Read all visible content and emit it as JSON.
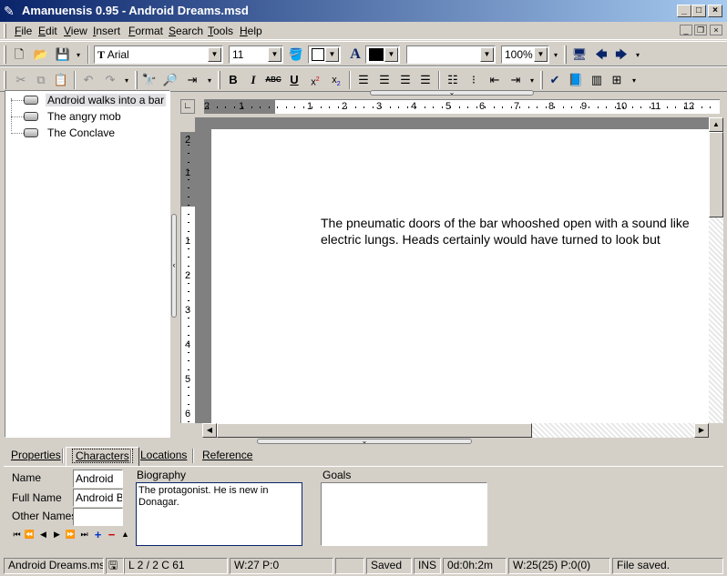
{
  "window": {
    "title": "Amanuensis 0.95 - Android Dreams.msd",
    "controls": {
      "minimize": "_",
      "maximize": "□",
      "close": "×"
    }
  },
  "menu": [
    "File",
    "Edit",
    "View",
    "Insert",
    "Format",
    "Search",
    "Tools",
    "Help"
  ],
  "toolbar": {
    "font_name": "Arial",
    "font_size": "11",
    "zoom": "100%",
    "style_value": "",
    "icons": [
      "new-document",
      "open-folder",
      "save-disk",
      "bold",
      "italic",
      "strikethrough",
      "underline",
      "superscript",
      "subscript",
      "align-left",
      "align-center",
      "align-right",
      "justify"
    ]
  },
  "tree": {
    "items": [
      {
        "label": "Android walks into a bar",
        "selected": true
      },
      {
        "label": "The angry mob",
        "selected": false
      },
      {
        "label": "The Conclave",
        "selected": false
      }
    ]
  },
  "ruler": {
    "horizontal": [
      "2",
      "1",
      "1",
      "2",
      "3",
      "4",
      "5",
      "6",
      "7",
      "8",
      "9",
      "10",
      "11",
      "12"
    ],
    "vertical": [
      "2",
      "1",
      "1",
      "2",
      "3",
      "4",
      "5",
      "6"
    ]
  },
  "document": {
    "lines": [
      "The pneumatic doors of the bar whooshed open with a sound like",
      "electric lungs. Heads certainly would have turned to look but"
    ]
  },
  "tabs": [
    {
      "label": "Properties",
      "active": false
    },
    {
      "label": "Characters",
      "active": true
    },
    {
      "label": "Locations",
      "active": false
    },
    {
      "label": "Reference",
      "active": false
    }
  ],
  "characters": {
    "name_label": "Name",
    "name_value": "Android",
    "full_name_label": "Full Name",
    "full_name_value": "Android Bl",
    "other_names_label": "Other Names",
    "other_names_value": "",
    "biography_label": "Biography",
    "biography_value": "The protagonist. He is new in Donagar.",
    "goals_label": "Goals",
    "goals_value": ""
  },
  "statusbar": {
    "file": "Android Dreams.msd",
    "position": "L 2 / 2  C 61",
    "words": "W:27  P:0",
    "blank": "",
    "saved": "Saved",
    "mode": "INS",
    "time": "0d:0h:2m",
    "total": "W:25(25)  P:0(0)",
    "message": "File saved."
  }
}
